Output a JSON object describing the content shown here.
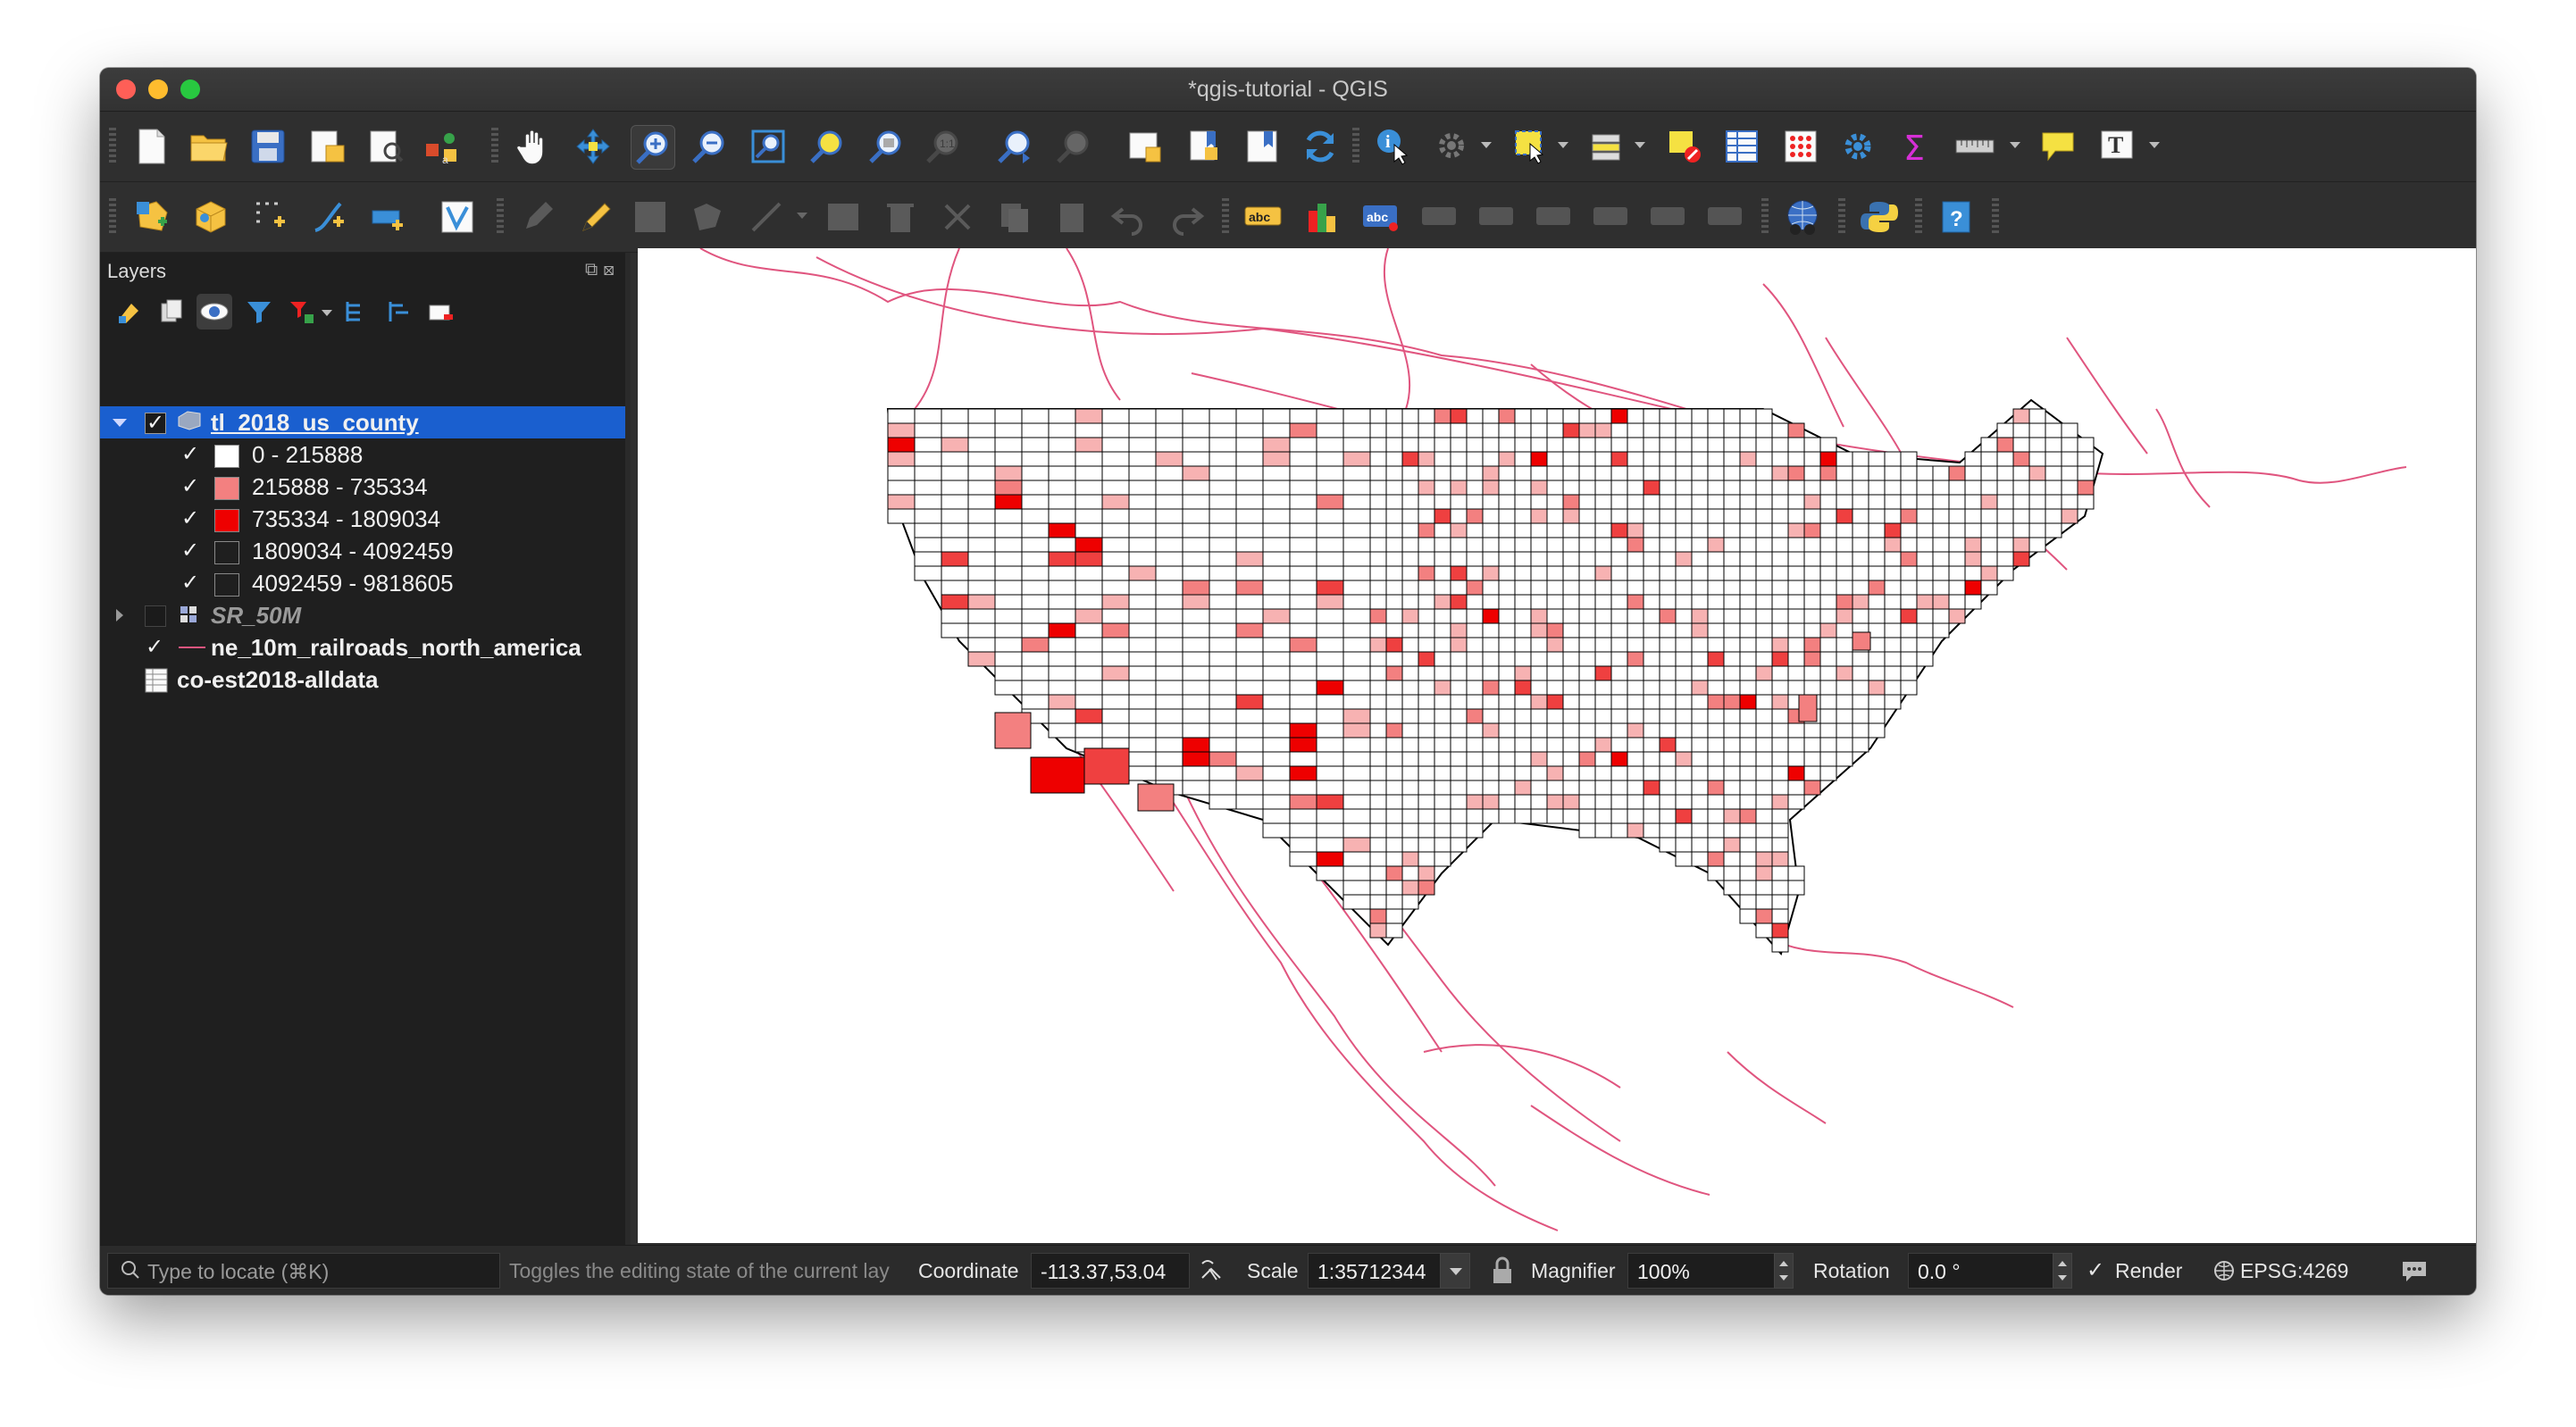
{
  "window": {
    "title": "*qgis-tutorial - QGIS"
  },
  "toolbar1": {
    "icons": [
      "new-project-icon",
      "open-project-icon",
      "save-project-icon",
      "print-layout-icon",
      "layout-manager-icon",
      "style-manager-icon",
      "pan-icon",
      "pan-to-selection-icon",
      "zoom-in-icon",
      "zoom-out-icon",
      "zoom-full-icon",
      "zoom-to-selection-icon",
      "zoom-to-layer-icon",
      "zoom-native-icon",
      "zoom-last-icon",
      "zoom-next-icon",
      "new-bookmark-icon",
      "show-bookmarks-icon",
      "new-map-view-icon",
      "refresh-icon",
      "identify-icon",
      "actions-icon",
      "select-features-icon",
      "select-by-value-icon",
      "deselect-icon",
      "attribute-table-icon",
      "field-calculator-icon",
      "toolbox-icon",
      "statistics-icon",
      "measure-icon",
      "map-tips-icon",
      "text-annotation-icon"
    ]
  },
  "toolbar2": {
    "icons": [
      "new-shapefile-icon",
      "new-geopackage-icon",
      "new-temp-layer-icon",
      "digitize-icon",
      "add-layer-icon",
      "vertex-tool-icon",
      "current-edits-icon",
      "toggle-editing-icon",
      "save-edits-icon",
      "add-feature-icon",
      "vertex-edit-icon",
      "modify-attributes-icon",
      "delete-selected-icon",
      "cut-features-icon",
      "copy-features-icon",
      "paste-features-icon",
      "undo-icon",
      "redo-icon",
      "label-toolbar-icon",
      "diagram-icon",
      "highlight-pin-icon",
      "pin-label-icon",
      "show-label-icon",
      "move-label-icon",
      "rotate-label-icon",
      "change-label-icon",
      "label-properties-icon",
      "plugin-globe-icon",
      "python-console-icon",
      "help-icon"
    ]
  },
  "layers_panel": {
    "title": "Layers",
    "layers": [
      {
        "name": "tl_2018_us_county",
        "checked": true,
        "expanded": true,
        "selected": true
      },
      {
        "name": "SR_50M",
        "checked": false,
        "expanded": false
      },
      {
        "name": "ne_10m_railroads_north_america",
        "checked": true
      },
      {
        "name": "co-est2018-alldata"
      }
    ],
    "legend": [
      {
        "label": "0 - 215888",
        "color": "#ffffff"
      },
      {
        "label": "215888 - 735334",
        "color": "#f7b2b2"
      },
      {
        "label": "735334 - 1809034",
        "color": "#f38080"
      },
      {
        "label": "1809034 - 4092459",
        "color": "#ef4040"
      },
      {
        "label": "4092459 - 9818605",
        "color": "#ee0000"
      }
    ],
    "railroad_color": "#e0557f"
  },
  "statusbar": {
    "locator_placeholder": "Type to locate (⌘K)",
    "message": "Toggles the editing state of the current lay",
    "coordinate_label": "Coordinate",
    "coordinate_value": "-113.37,53.04",
    "scale_label": "Scale",
    "scale_value": "1:35712344",
    "magnifier_label": "Magnifier",
    "magnifier_value": "100%",
    "rotation_label": "Rotation",
    "rotation_value": "0.0 °",
    "render_label": "Render",
    "render_checked": true,
    "crs": "EPSG:4269"
  }
}
